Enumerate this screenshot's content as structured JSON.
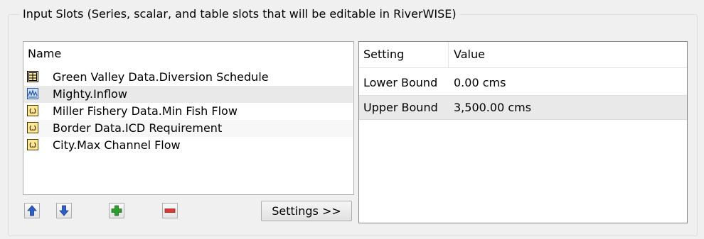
{
  "group": {
    "title": "Input Slots (Series, scalar, and table slots that will be editable in RiverWISE)"
  },
  "slot_list": {
    "header": "Name",
    "items": [
      {
        "label": "Green Valley Data.Diversion Schedule",
        "icon": "periodic-slot-icon",
        "selected": false,
        "alt": false
      },
      {
        "label": "Mighty.Inflow",
        "icon": "series-slot-icon",
        "selected": true,
        "alt": false
      },
      {
        "label": "Miller Fishery Data.Min Fish Flow",
        "icon": "scalar-slot-icon",
        "selected": false,
        "alt": false
      },
      {
        "label": "Border Data.ICD Requirement",
        "icon": "scalar-slot-icon",
        "selected": false,
        "alt": true
      },
      {
        "label": "City.Max Channel Flow",
        "icon": "scalar-slot-icon",
        "selected": false,
        "alt": false
      }
    ]
  },
  "toolbar": {
    "move_up_icon": "arrow-up-icon",
    "move_down_icon": "arrow-down-icon",
    "add_icon": "plus-icon",
    "remove_icon": "minus-icon",
    "settings_label": "Settings >>"
  },
  "settings_table": {
    "columns": [
      "Setting",
      "Value"
    ],
    "rows": [
      {
        "setting": "Lower Bound",
        "value": "0.00 cms",
        "selected": false
      },
      {
        "setting": "Upper Bound",
        "value": "3,500.00 cms",
        "selected": true
      }
    ]
  },
  "colors": {
    "background": "#f0f0f0",
    "selection": "#e9e9e9",
    "arrow_blue": "#2f5fc4",
    "add_green": "#2e9e2e",
    "remove_red": "#d83a3a"
  }
}
